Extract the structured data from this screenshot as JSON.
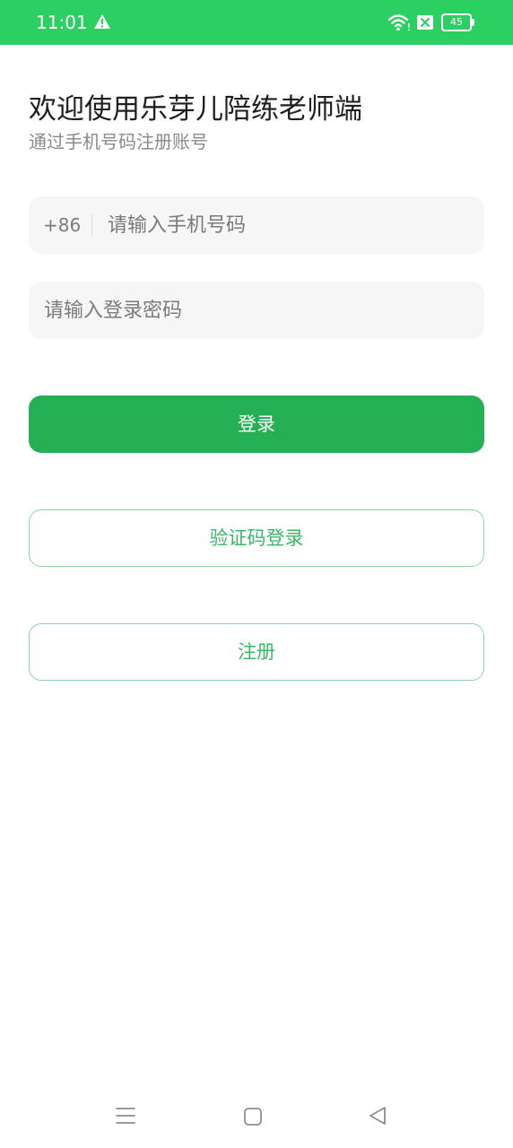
{
  "status_bar": {
    "time": "11:01",
    "battery_level": "45",
    "background_color": "#2bcf62",
    "icons": [
      "warning-icon",
      "wifi-icon",
      "sim-icon",
      "battery-icon"
    ]
  },
  "header": {
    "title": "欢迎使用乐芽儿陪练老师端",
    "subtitle": "通过手机号码注册账号"
  },
  "phone_field": {
    "country_code": "+86",
    "placeholder": "请输入手机号码",
    "value": ""
  },
  "password_field": {
    "placeholder": "请输入登录密码",
    "value": ""
  },
  "buttons": {
    "login": "登录",
    "sms_login": "验证码登录",
    "register": "注册"
  },
  "colors": {
    "primary": "#26b055",
    "outline_text": "#3cb765",
    "outline_border": "#8fd3a3"
  },
  "nav_bar": {
    "icons": [
      "menu-icon",
      "home-icon",
      "back-icon"
    ]
  }
}
